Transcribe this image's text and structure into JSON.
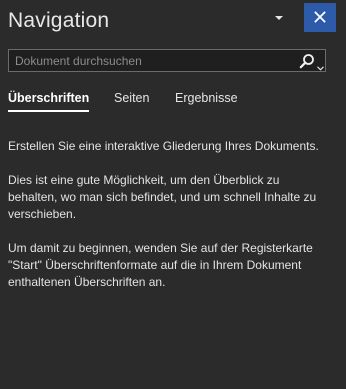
{
  "pane": {
    "title": "Navigation",
    "dropdown_icon": "chevron-down-icon",
    "close_icon": "close-icon",
    "accent_color": "#2e5ba9"
  },
  "search": {
    "placeholder": "Dokument durchsuchen",
    "value": "",
    "button_icon": "search-icon"
  },
  "tabs": [
    {
      "label": "Überschriften",
      "active": true
    },
    {
      "label": "Seiten",
      "active": false
    },
    {
      "label": "Ergebnisse",
      "active": false
    }
  ],
  "content": {
    "paragraphs": [
      "Erstellen Sie eine interaktive Gliederung Ihres Dokuments.",
      "Dies ist eine gute Möglichkeit, um den Überblick zu behalten, wo man sich befindet, und um schnell Inhalte zu verschieben.",
      "Um damit zu beginnen, wenden Sie auf der Registerkarte \"Start\" Überschriftenformate auf die in Ihrem Dokument enthaltenen Überschriften an."
    ]
  }
}
